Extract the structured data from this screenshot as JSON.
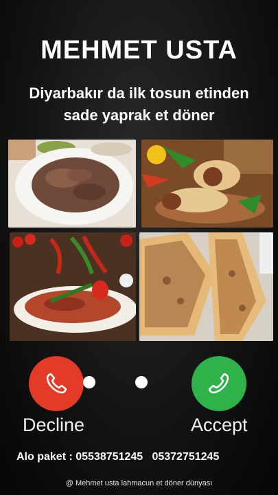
{
  "header": {
    "title": "MEHMET USTA",
    "subtitle_line1": "Diyarbakır da ilk tosun etinden",
    "subtitle_line2": "sade yaprak et döner"
  },
  "photos": [
    {
      "icon": "doner-plate-image"
    },
    {
      "icon": "wrap-doner-image"
    },
    {
      "icon": "iskender-plate-image"
    },
    {
      "icon": "lahmacun-pide-image"
    }
  ],
  "call": {
    "decline_label": "Decline",
    "accept_label": "Accept",
    "decline_color": "#e43b28",
    "accept_color": "#2fb24a",
    "decline_icon": "phone-hangup-icon",
    "accept_icon": "phone-icon"
  },
  "contact": {
    "phone_line": "Alo paket : 05538751245   05372751245"
  },
  "footer": {
    "credit": "@ Mehmet usta lahmacun et döner dünyası"
  }
}
